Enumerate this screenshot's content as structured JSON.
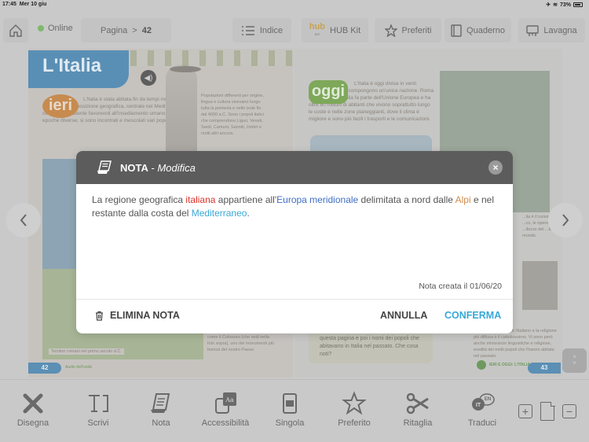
{
  "status_bar": {
    "time": "17:45",
    "date": "Mer 10 giu",
    "battery": "73%"
  },
  "toolbar": {
    "online_label": "Online",
    "online_color": "#7fb86e",
    "page_label": "Pagina",
    "page_separator": ">",
    "page_number": "42",
    "indice_label": "Indice",
    "hubkit_logo": "hub",
    "hubkit_logo_sub": "KIT",
    "hubkit_label": "HUB Kit",
    "preferiti_label": "Preferiti",
    "quaderno_label": "Quaderno",
    "lavagna_label": "Lavagna"
  },
  "book": {
    "left_page": {
      "title": "L'Italia",
      "ieri_badge": "ieri",
      "ieri_text": "L'Italia è stata abitata fin da tempi molti antichi grazie alla sua posizione geografica, centrale nel Mediterraneo, al clima e all'ambiente favorevoli all'insediamento umano. Qui in epoche diverse, si sono incontrati e mescolati vari popoli e culture.",
      "popoli_text": "Popolazioni differenti per origine, lingua e cultura vivevano lungo tutta la penisola e nelle isole fin dal 4000 a.C. Sono i popoli italici che comprendono Liguri, Veneti, Sardi, Camuni, Sanniti, Umbri e molti altri ancora.",
      "map_legend": "Territori romani nel primo secolo d.C.",
      "bottom_text": "testimonianze di questa civiltà, come il Colosseo (che vedi nella foto sopra), uno dei monumenti più famosi del nostro Paese.",
      "page_number": "42",
      "audio_label": "Audio dell'unità"
    },
    "right_page": {
      "oggi_badge": "oggi",
      "oggi_text": "L'Italia è oggi divisa in venti regioni, che però compongono un'unica nazione. Roma è la capitale. L'Italia fa parte dell'Unione Europea e ha oltre 60 milioni di abitanti che vivono soprattutto lungo le coste e nelle zone pianeggianti, dove il clima è migliore e sono più facili i trasporti e le comunicazioni.",
      "side_text": "...lia è il turismo ...co, le opere ...llezze del ...tto il mondo.",
      "question_text": "i nomi delle regioni italiane presenti in questa pagina e poi i nomi dei popoli che abitavano in Italia nel passato. Che cosa noti?",
      "bottom_text": "La lingua principale è l'italiano e la religione più diffusa è il cattolicesimo. Vi sono però anche minoranze linguistiche e religiose, eredità dei molti popoli che l'hanno abitata nel passato.",
      "link_label": "IERI E OGGI: L'ITALIA",
      "page_number": "43"
    }
  },
  "navigation": {
    "prev_icon": "chevron-left-icon",
    "next_icon": "chevron-right-icon",
    "scroll_up": "˄",
    "scroll_down": "˅"
  },
  "modal": {
    "title_bold": "NOTA",
    "title_sep": " - ",
    "title_italic": "Modifica",
    "close_label": "×",
    "note_segments": [
      {
        "text": "La regione geografica ",
        "color": "default"
      },
      {
        "text": "italiana",
        "color": "#d9332b"
      },
      {
        "text": " appartiene all'",
        "color": "default"
      },
      {
        "text": "Europa meridionale",
        "color": "#3f6fc2"
      },
      {
        "text": " delimitata a nord dalle ",
        "color": "default"
      },
      {
        "text": "Alpi",
        "color": "#d18b4c"
      },
      {
        "text": " e nel restante dalla costa del ",
        "color": "default"
      },
      {
        "text": "Mediterraneo",
        "color": "#38a8d6"
      },
      {
        "text": ".",
        "color": "default"
      }
    ],
    "created_label": "Nota creata il 01/06/20",
    "delete_label": "ELIMINA NOTA",
    "cancel_label": "ANNULLA",
    "confirm_label": "CONFERMA",
    "confirm_color": "#38a8d6"
  },
  "bottom_toolbar": {
    "tools": [
      {
        "label": "Disegna",
        "icon": "pencil-brush-icon"
      },
      {
        "label": "Scrivi",
        "icon": "text-box-icon"
      },
      {
        "label": "Nota",
        "icon": "note-scroll-icon"
      },
      {
        "label": "Accessibilità",
        "icon": "accessibility-font-icon"
      },
      {
        "label": "Singola",
        "icon": "single-page-icon"
      },
      {
        "label": "Preferito",
        "icon": "star-icon"
      },
      {
        "label": "Ritaglia",
        "icon": "scissors-icon"
      },
      {
        "label": "Traduci",
        "icon": "translate-icon"
      }
    ],
    "zoom_in": "+",
    "zoom_out": "−",
    "translate_from": "IT",
    "translate_to": "EN",
    "accessibility_glyph": "Aa"
  }
}
